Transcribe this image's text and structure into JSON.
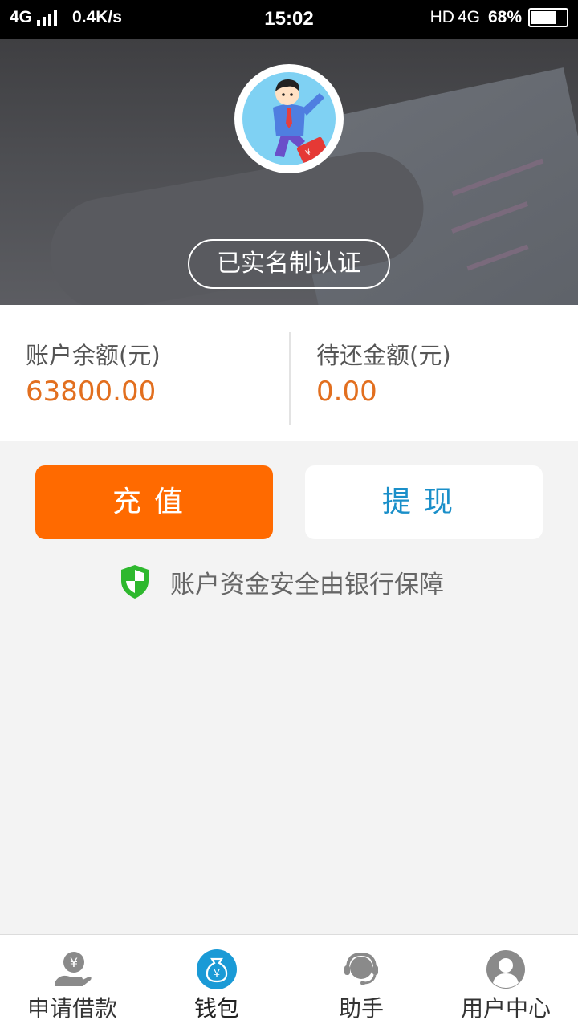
{
  "status_bar": {
    "network": "4G",
    "speed": "0.4K/s",
    "time": "15:02",
    "hd": "HD",
    "network_right": "4G",
    "battery": "68%"
  },
  "header": {
    "verify_label": "已实名制认证"
  },
  "balance": {
    "account_label": "账户余额(元)",
    "account_value": "63800.00",
    "due_label": "待还金额(元)",
    "due_value": "0.00"
  },
  "actions": {
    "recharge": "充值",
    "withdraw": "提现"
  },
  "security_text": "账户资金安全由银行保障",
  "nav": {
    "items": [
      {
        "label": "申请借款",
        "icon": "hand-yen-icon"
      },
      {
        "label": "钱包",
        "icon": "money-bag-icon",
        "active": true
      },
      {
        "label": "助手",
        "icon": "headset-icon"
      },
      {
        "label": "用户中心",
        "icon": "user-icon"
      }
    ]
  },
  "colors": {
    "accent_orange": "#ff6a00",
    "value_orange": "#e26f1f",
    "withdraw_blue": "#1a8fc9",
    "nav_active_blue": "#1a9ad6",
    "shield_green": "#2eb82e"
  }
}
